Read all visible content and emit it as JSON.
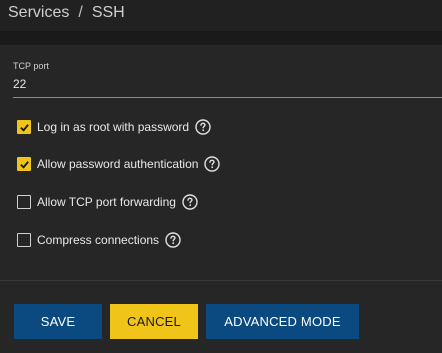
{
  "breadcrumb": {
    "parent": "Services",
    "separator": "/",
    "current": "SSH"
  },
  "form": {
    "tcp_port": {
      "label": "TCP port",
      "value": "22"
    },
    "options": [
      {
        "label": "Log in as root with password",
        "checked": true
      },
      {
        "label": "Allow password authentication",
        "checked": true
      },
      {
        "label": "Allow TCP port forwarding",
        "checked": false
      },
      {
        "label": "Compress connections",
        "checked": false
      }
    ]
  },
  "buttons": {
    "save": "SAVE",
    "cancel": "CANCEL",
    "advanced": "ADVANCED MODE"
  },
  "icons": {
    "check": "check-icon",
    "help": "help-circle-icon"
  },
  "colors": {
    "accent_yellow": "#f0c419",
    "primary_blue": "#0b4a80",
    "background": "#212121",
    "panel": "#262626"
  }
}
